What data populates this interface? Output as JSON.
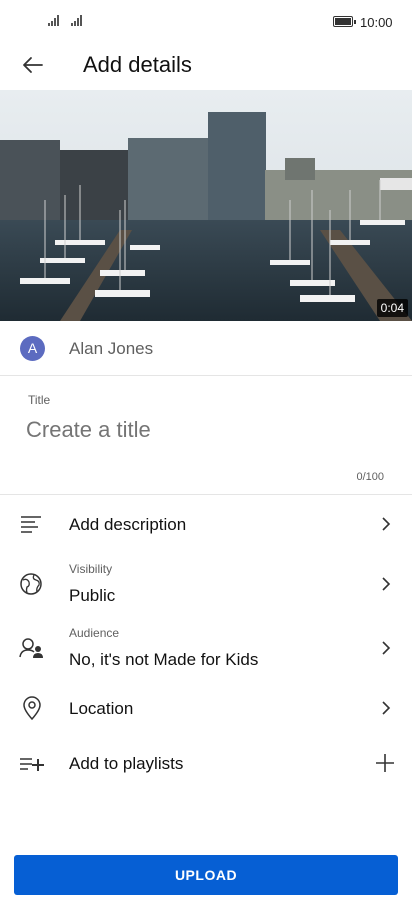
{
  "status_bar": {
    "time": "10:00"
  },
  "app_bar": {
    "title": "Add details"
  },
  "video": {
    "duration": "0:04"
  },
  "account": {
    "avatar_letter": "A",
    "name": "Alan Jones"
  },
  "title_field": {
    "label": "Title",
    "placeholder": "Create a title",
    "value": "",
    "counter": "0/100"
  },
  "options": {
    "description": {
      "label": "Add description"
    },
    "visibility": {
      "caption": "Visibility",
      "value": "Public"
    },
    "audience": {
      "caption": "Audience",
      "value": "No, it's not Made for Kids"
    },
    "location": {
      "label": "Location"
    },
    "playlists": {
      "label": "Add to playlists"
    }
  },
  "upload_button": {
    "label": "UPLOAD"
  },
  "colors": {
    "accent": "#065fd4",
    "avatar": "#5c6bc0"
  },
  "icons": [
    "signal-icon",
    "battery-icon",
    "back-arrow-icon",
    "description-icon",
    "globe-icon",
    "audience-icon",
    "location-pin-icon",
    "playlist-add-icon",
    "chevron-right-icon",
    "plus-icon"
  ]
}
